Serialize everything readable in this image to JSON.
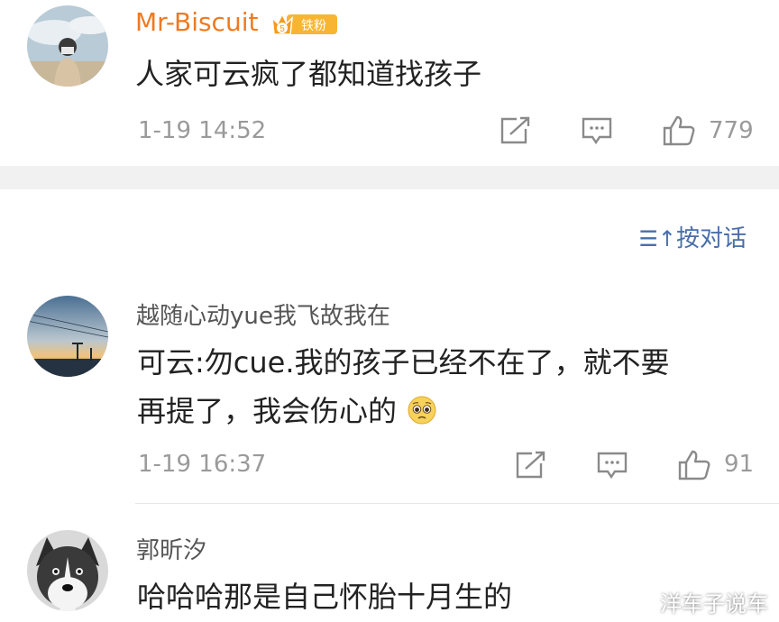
{
  "comments": [
    {
      "username": "Mr-Biscuit",
      "fan_badge_level": "5",
      "fan_badge_label": "铁粉",
      "lines": [
        "人家可云疯了都知道找孩子"
      ],
      "time": "1-19 14:52",
      "like_count": "779",
      "icons": [
        "repost-icon",
        "comment-icon",
        "like-icon"
      ]
    },
    {
      "username": "越随心动yue我飞故我在",
      "lines": [
        "可云:勿cue.我的孩子已经不在了，就不要",
        "再提了，我会伤心的"
      ],
      "emoji": "pleading-face-emoji",
      "time": "1-19 16:37",
      "like_count": "91",
      "icons": [
        "repost-icon",
        "comment-icon",
        "like-icon"
      ]
    },
    {
      "username": "郭昕汐",
      "lines": [
        "哈哈哈那是自己怀胎十月生的"
      ]
    }
  ],
  "sort_toggle": {
    "icon": "sort-icon",
    "label": "按对话"
  },
  "watermark": "洋车子说车",
  "colors": {
    "username_vip": "#ee7a21",
    "username": "#555555",
    "link": "#4a6ea9",
    "meta": "#9a9a9a",
    "separator": "#f1f1f1"
  }
}
